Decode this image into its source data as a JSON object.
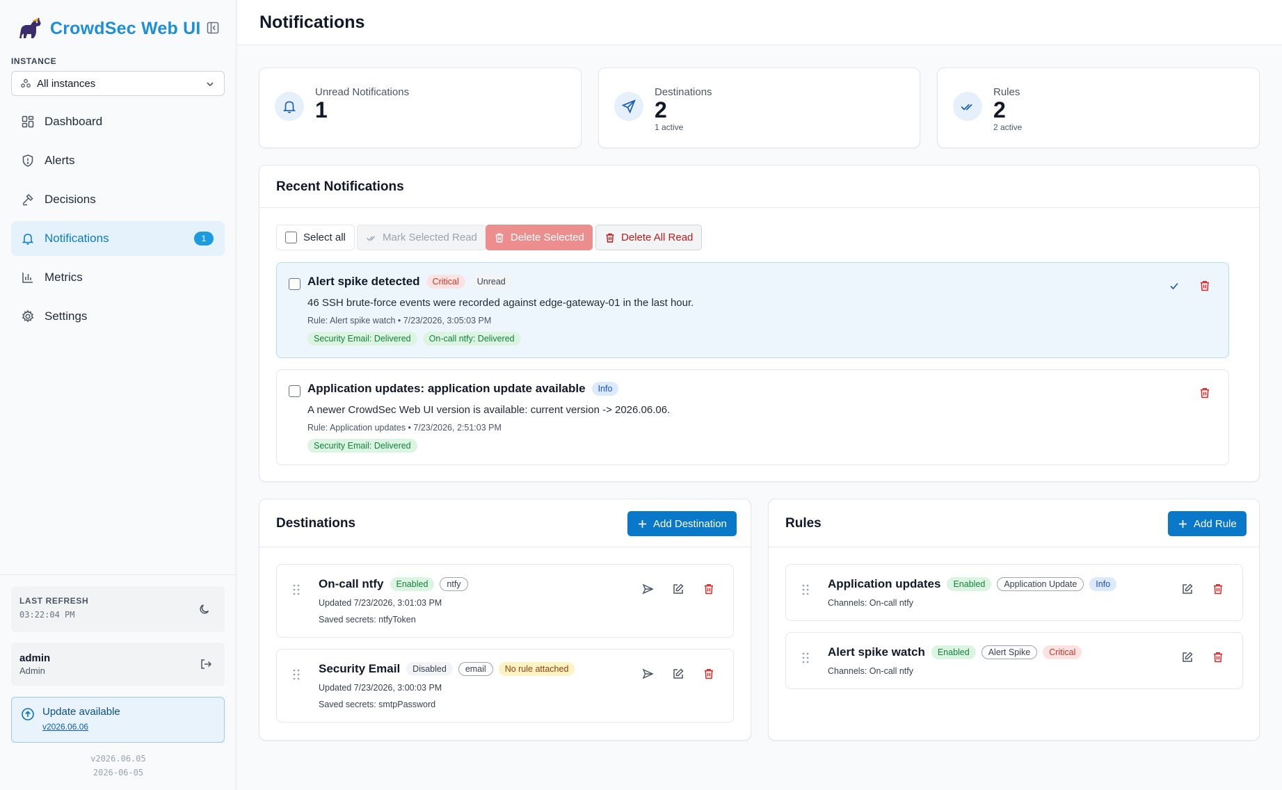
{
  "app": {
    "title": "CrowdSec Web UI"
  },
  "instance": {
    "label": "INSTANCE",
    "selected": "All instances"
  },
  "nav": [
    {
      "label": "Dashboard",
      "icon": "dashboard-icon"
    },
    {
      "label": "Alerts",
      "icon": "shield-icon"
    },
    {
      "label": "Decisions",
      "icon": "gavel-icon"
    },
    {
      "label": "Notifications",
      "icon": "bell-icon",
      "badge": "1",
      "active": true
    },
    {
      "label": "Metrics",
      "icon": "bar-chart-icon"
    },
    {
      "label": "Settings",
      "icon": "gear-icon"
    }
  ],
  "refresh": {
    "label": "LAST REFRESH",
    "time": "03:22:04 PM"
  },
  "user": {
    "name": "admin",
    "role": "Admin"
  },
  "update": {
    "title": "Update available",
    "link": "v2026.06.06"
  },
  "version": {
    "number": "v2026.06.05",
    "date": "2026-06-05"
  },
  "page": {
    "title": "Notifications"
  },
  "stats": [
    {
      "label": "Unread Notifications",
      "value": "1",
      "sub": ""
    },
    {
      "label": "Destinations",
      "value": "2",
      "sub": "1 active"
    },
    {
      "label": "Rules",
      "value": "2",
      "sub": "2 active"
    }
  ],
  "recent": {
    "title": "Recent Notifications",
    "select_all": "Select all",
    "mark_read": "Mark Selected Read",
    "delete_selected": "Delete Selected",
    "delete_all_read": "Delete All Read",
    "items": [
      {
        "title": "Alert spike detected",
        "badges": [
          "Critical",
          "Unread"
        ],
        "message": "46 SSH brute-force events were recorded against edge-gateway-01 in the last hour.",
        "meta": "Rule: Alert spike watch • 7/23/2026, 3:05:03 PM",
        "tags": [
          "Security Email: Delivered",
          "On-call ntfy: Delivered"
        ]
      },
      {
        "title": "Application updates: application update available",
        "badges": [
          "Info"
        ],
        "message": "A newer CrowdSec Web UI version is available: current version -> 2026.06.06.",
        "meta": "Rule: Application updates • 7/23/2026, 2:51:03 PM",
        "tags": [
          "Security Email: Delivered"
        ]
      }
    ]
  },
  "destinations": {
    "title": "Destinations",
    "add_label": "Add Destination",
    "items": [
      {
        "name": "On-call ntfy",
        "status": "Enabled",
        "type": "ntfy",
        "warning": "",
        "updated": "Updated 7/23/2026, 3:01:03 PM",
        "secrets": "Saved secrets: ntfyToken"
      },
      {
        "name": "Security Email",
        "status": "Disabled",
        "type": "email",
        "warning": "No rule attached",
        "updated": "Updated 7/23/2026, 3:00:03 PM",
        "secrets": "Saved secrets: smtpPassword"
      }
    ]
  },
  "rules": {
    "title": "Rules",
    "add_label": "Add Rule",
    "items": [
      {
        "name": "Application updates",
        "status": "Enabled",
        "type": "Application Update",
        "severity": "Info",
        "channels": "Channels: On-call ntfy"
      },
      {
        "name": "Alert spike watch",
        "status": "Enabled",
        "type": "Alert Spike",
        "severity": "Critical",
        "channels": "Channels: On-call ntfy"
      }
    ]
  },
  "colors": {
    "brand": "#1d8fd8",
    "primary_button": "#0a78c8",
    "danger": "#dc2626"
  }
}
